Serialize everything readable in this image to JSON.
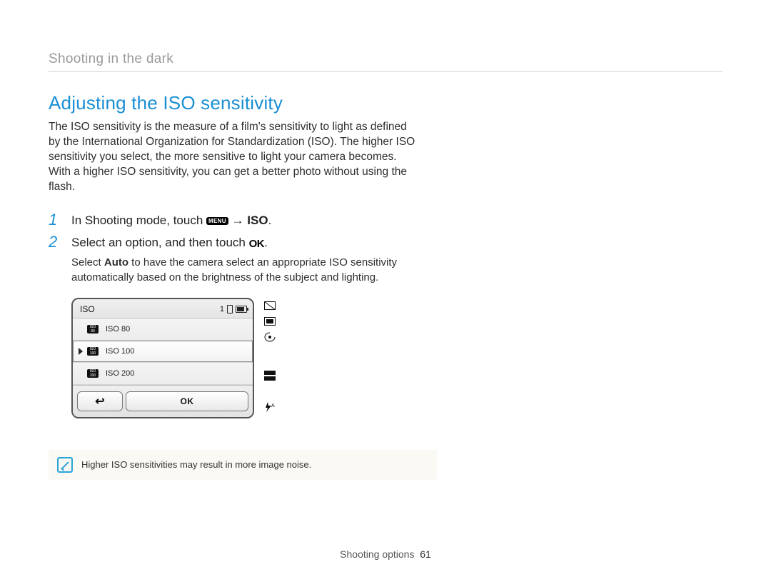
{
  "breadcrumb": "Shooting in the dark",
  "heading": "Adjusting the ISO sensitivity",
  "intro": "The ISO sensitivity is the measure of a film's sensitivity to light as defined by the International Organization for Standardization (ISO). The higher ISO sensitivity you select, the more sensitive to light your camera becomes. With a higher ISO sensitivity, you can get a better photo without using the flash.",
  "steps": {
    "s1_num": "1",
    "s1_prefix": "In Shooting mode, touch ",
    "s1_menu": "MENU",
    "s1_arrow": " → ",
    "s1_iso": "ISO",
    "s2_num": "2",
    "s2_prefix": "Select an option, and then touch ",
    "s2_ok": "OK",
    "s2_suffix": "."
  },
  "subnote_a": "Select ",
  "subnote_bold": "Auto",
  "subnote_b": " to have the camera select an appropriate ISO sensitivity automatically based on the brightness of the subject and lighting.",
  "lcd": {
    "title": "ISO",
    "count": "1",
    "rows": [
      {
        "label": "ISO 80",
        "chip_top": "ISO",
        "chip_bot": "80",
        "selected": false
      },
      {
        "label": "ISO 100",
        "chip_top": "ISO",
        "chip_bot": "100",
        "selected": true
      },
      {
        "label": "ISO 200",
        "chip_top": "ISO",
        "chip_bot": "200",
        "selected": false
      }
    ],
    "ok_label": "OK"
  },
  "note": "Higher ISO sensitivities may result in more image noise.",
  "footer_section": "Shooting options",
  "footer_page": "61"
}
